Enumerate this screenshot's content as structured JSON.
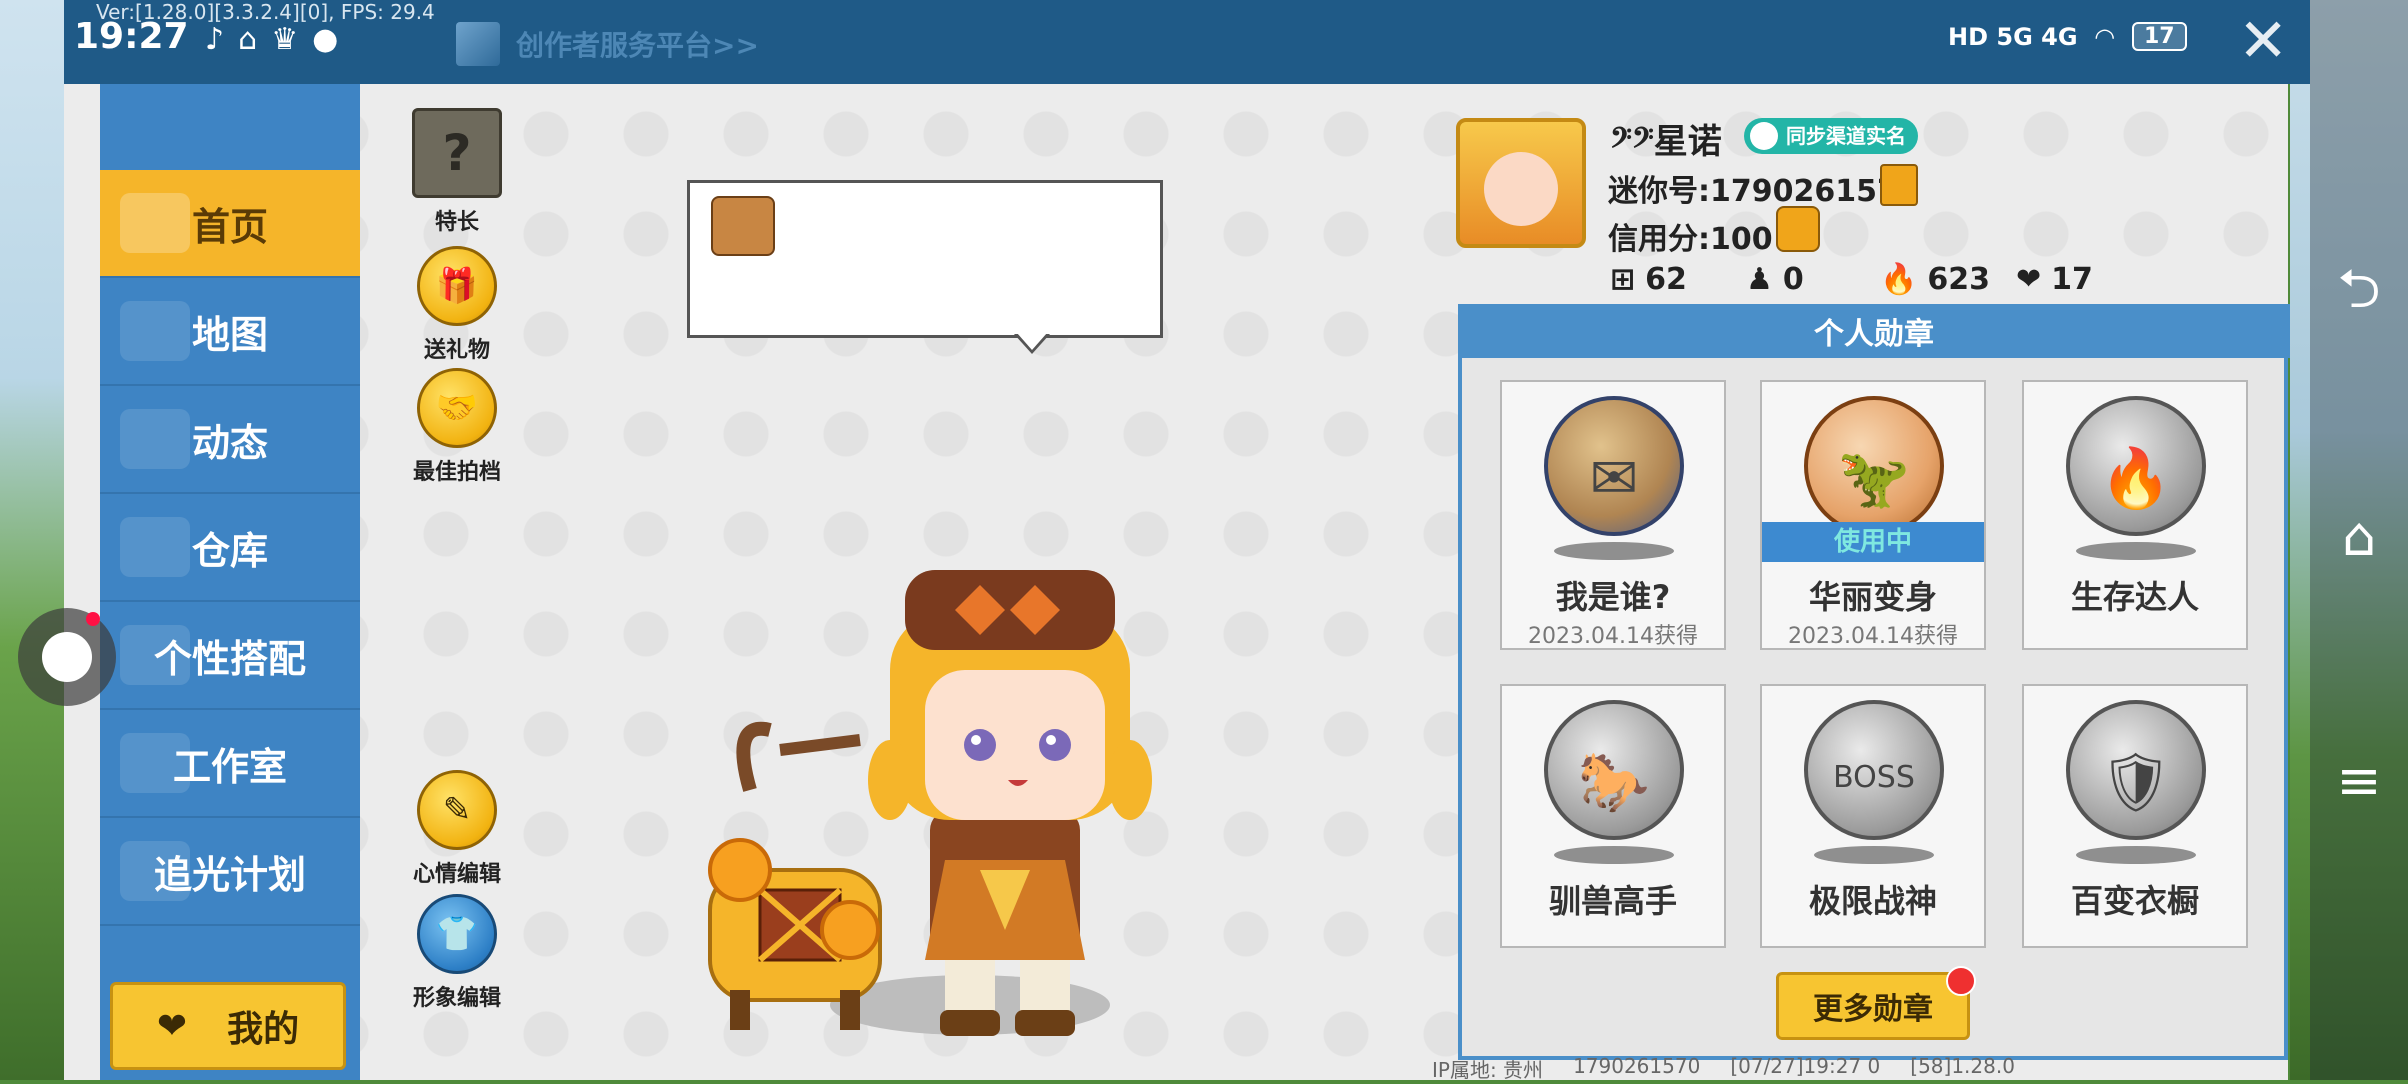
{
  "status_bar": {
    "time": "19:27",
    "version": "Ver:[1.28.0][3.3.2.4][0], FPS: 29.4",
    "creator_link": "创作者服务平台>>",
    "battery": "17",
    "network": "HD 5G 4G"
  },
  "nav": {
    "items": [
      {
        "label": "首页",
        "active": true
      },
      {
        "label": "地图"
      },
      {
        "label": "动态"
      },
      {
        "label": "仓库"
      },
      {
        "label": "个性搭配"
      },
      {
        "label": "工作室"
      },
      {
        "label": "追光计划"
      }
    ],
    "my_label": "我的"
  },
  "actions": {
    "specialty": "特长",
    "gift": "送礼物",
    "partner": "最佳拍档",
    "mood": "心情编辑",
    "image": "形象编辑"
  },
  "profile": {
    "nickname": "𝄢𝄢星诺",
    "realname_badge": "同步渠道实名",
    "mini_id": "迷你号:1790261570",
    "credit": "信用分:100",
    "stats": [
      "62",
      "0",
      "623",
      "17"
    ]
  },
  "medals": {
    "header": "个人勋章",
    "in_use": "使用中",
    "items": [
      {
        "name": "我是谁?",
        "date": "2023.04.14获得"
      },
      {
        "name": "华丽变身",
        "date": "2023.04.14获得"
      },
      {
        "name": "生存达人"
      },
      {
        "name": "驯兽高手"
      },
      {
        "name": "极限战神"
      },
      {
        "name": "百变衣橱"
      }
    ],
    "more_label": "更多勋章"
  },
  "footer": {
    "ip": "IP属地: 贵州",
    "uid": "1790261570",
    "stamp": "[07/27]19:27 0",
    "ver": "[58]1.28.0"
  },
  "colors": {
    "nav_bg": "#3e84c4",
    "nav_active": "#f5b52a",
    "status_bg": "#1f5a87",
    "accent_yellow": "#f7c531",
    "medal_header": "#4a8fc9"
  }
}
